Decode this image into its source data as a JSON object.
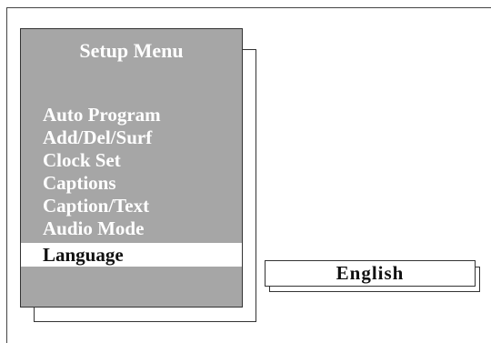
{
  "menu": {
    "title": "Setup Menu",
    "items": [
      {
        "label": "Auto Program"
      },
      {
        "label": "Add/Del/Surf"
      },
      {
        "label": "Clock Set"
      },
      {
        "label": "Captions"
      },
      {
        "label": "Caption/Text"
      },
      {
        "label": "Audio Mode"
      },
      {
        "label": "Language"
      }
    ],
    "selected_item": "Language"
  },
  "value_box": {
    "value": "English"
  },
  "colors": {
    "panel_background": "#a6a6a6",
    "menu_text": "#ffffff",
    "selected_background": "#ffffff",
    "selected_text": "#111111"
  }
}
